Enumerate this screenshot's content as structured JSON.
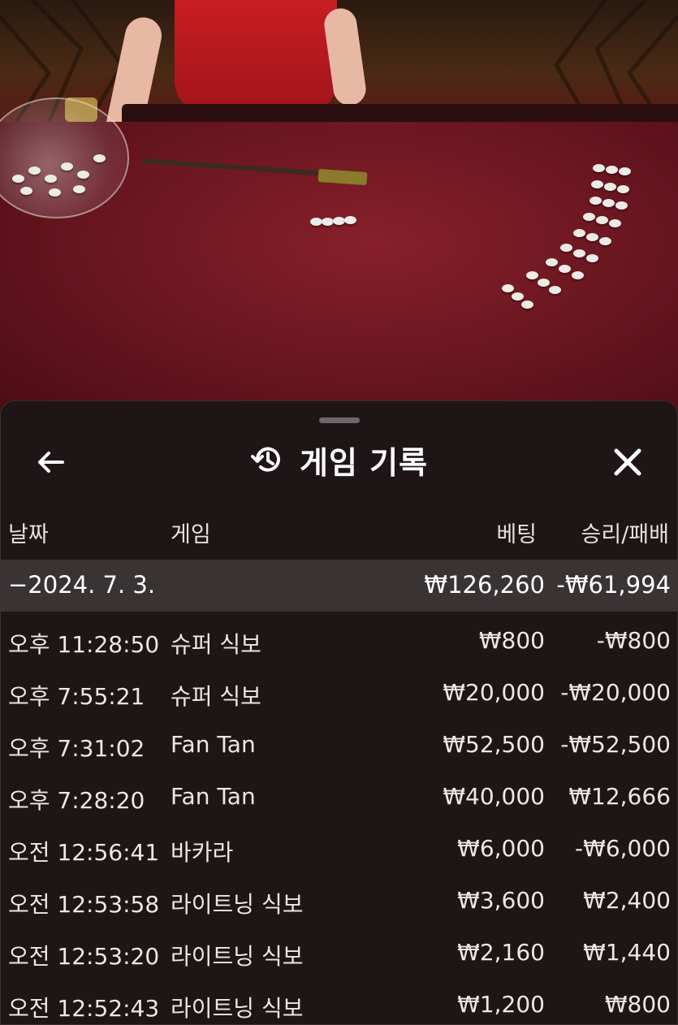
{
  "header": {
    "title": "게임 기록",
    "back_icon": "arrow-left-icon",
    "history_icon": "history-clock-icon",
    "close_icon": "close-icon"
  },
  "columns": {
    "date": "날짜",
    "game": "게임",
    "bet": "베팅",
    "winloss": "승리/패배"
  },
  "group": {
    "date": "−2024. 7. 3.",
    "bet_total": "₩126,260",
    "winloss_total": "-₩61,994"
  },
  "rows": [
    {
      "time": "오후 11:28:50",
      "game": "슈퍼 식보",
      "bet": "₩800",
      "winloss": "-₩800"
    },
    {
      "time": "오후 7:55:21",
      "game": "슈퍼 식보",
      "bet": "₩20,000",
      "winloss": "-₩20,000"
    },
    {
      "time": "오후 7:31:02",
      "game": "Fan Tan",
      "bet": "₩52,500",
      "winloss": "-₩52,500"
    },
    {
      "time": "오후 7:28:20",
      "game": "Fan Tan",
      "bet": "₩40,000",
      "winloss": "₩12,666"
    },
    {
      "time": "오전 12:56:41",
      "game": "바카라",
      "bet": "₩6,000",
      "winloss": "-₩6,000"
    },
    {
      "time": "오전 12:53:58",
      "game": "라이트닝 식보",
      "bet": "₩3,600",
      "winloss": "₩2,400"
    },
    {
      "time": "오전 12:53:20",
      "game": "라이트닝 식보",
      "bet": "₩2,160",
      "winloss": "₩1,440"
    },
    {
      "time": "오전 12:52:43",
      "game": "라이트닝 식보",
      "bet": "₩1,200",
      "winloss": "₩800"
    }
  ],
  "colors": {
    "sheet_bg": "#1d1516",
    "group_bg": "#3a3334",
    "felt": "#6a1620"
  }
}
